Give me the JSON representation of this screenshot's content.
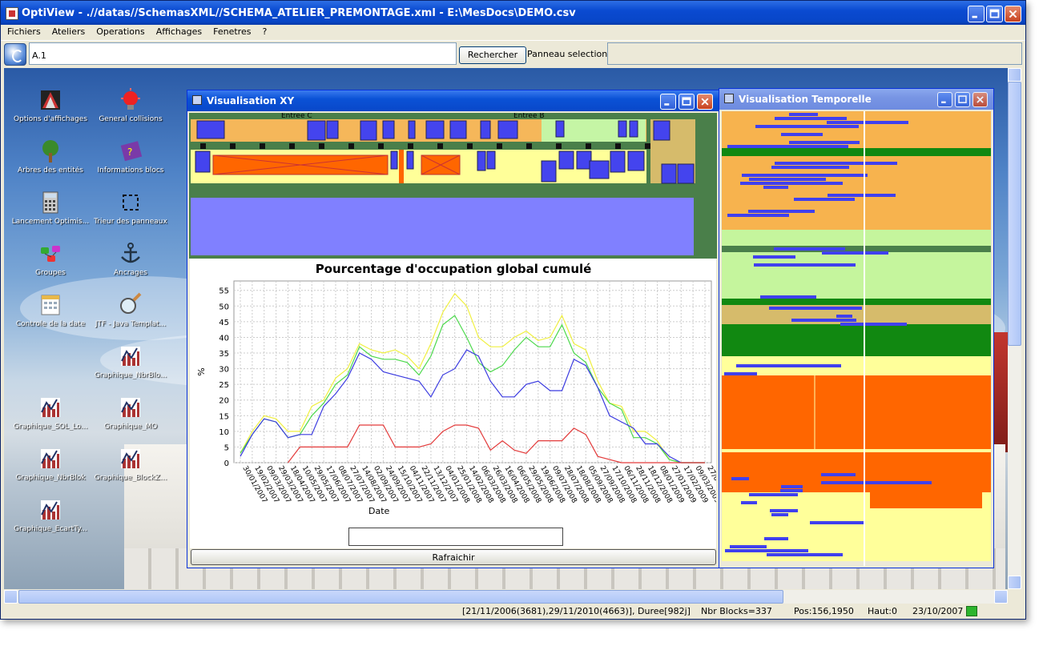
{
  "window": {
    "title": "OptiView - .//datas//SchemasXML//SCHEMA_ATELIER_PREMONTAGE.xml - E:\\MesDocs\\DEMO.csv"
  },
  "menu": [
    "Fichiers",
    "Ateliers",
    "Operations",
    "Affichages",
    "Fenetres",
    "?"
  ],
  "toolbar": {
    "search_value": "A.1",
    "search_button": "Rechercher",
    "panel_label": "Panneau selectionne"
  },
  "desktop_icons": [
    {
      "label": "Options d'affichages",
      "icon": "display-options-icon"
    },
    {
      "label": "General collisions",
      "icon": "collision-alarm-icon"
    },
    {
      "label": "Arbres des entités",
      "icon": "tree-icon"
    },
    {
      "label": "Informations blocs",
      "icon": "help-book-icon"
    },
    {
      "label": "Lancement Optimis...",
      "icon": "calculator-icon"
    },
    {
      "label": "Trieur des panneaux",
      "icon": "sorter-icon"
    },
    {
      "label": "Groupes",
      "icon": "groups-icon"
    },
    {
      "label": "Ancrages",
      "icon": "anchor-icon"
    },
    {
      "label": "Controle de la date",
      "icon": "calendar-icon"
    },
    {
      "label": "JTF - Java Templat...",
      "icon": "magnifier-icon"
    },
    {
      "label": "Graphique_NbrBlo...",
      "icon": "chart-icon"
    },
    {
      "label": "Graphique_SOL_Lo...",
      "icon": "chart-icon"
    },
    {
      "label": "Graphique_MO",
      "icon": "chart-icon"
    },
    {
      "label": "Graphique_NbrBlok",
      "icon": "chart-icon"
    },
    {
      "label": "Graphique_BlockZ...",
      "icon": "chart-icon"
    },
    {
      "label": "Graphique_EcartTy...",
      "icon": "chart-icon"
    }
  ],
  "xy_window": {
    "title": "Visualisation XY",
    "labels": [
      "Entree C",
      "Entree B"
    ],
    "refresh_label": "Rafraichir",
    "input_value": ""
  },
  "temporal_window": {
    "title": "Visualisation Temporelle"
  },
  "status": {
    "range": "[21/11/2006(3681),29/11/2010(4663)], Duree[982j]",
    "blocks": "Nbr Blocks=337",
    "pos": "Pos:156,1950",
    "haut": "Haut:0",
    "date": "23/10/2007"
  },
  "colors": {
    "title_bar": "#0a4ad1",
    "grid": "#cccccc",
    "series_red": "#e33b3b",
    "series_blue": "#3b3be0",
    "series_green": "#4cd94c",
    "series_yellow": "#f0f040"
  },
  "chart_data": {
    "type": "line",
    "title": "Pourcentage d'occupation global cumulé",
    "xlabel": "Date",
    "ylabel": "%",
    "ylim": [
      0,
      58
    ],
    "yticks": [
      0,
      5,
      10,
      15,
      20,
      25,
      30,
      35,
      40,
      45,
      50,
      55
    ],
    "grid": true,
    "categories": [
      "30/01/2007",
      "19/02/2007",
      "09/03/2007",
      "29/03/2007",
      "18/04/2007",
      "10/05/2007",
      "29/05/2007",
      "17/06/2007",
      "08/07/2007",
      "27/07/2007",
      "14/08/2007",
      "02/09/2007",
      "24/09/2007",
      "15/10/2007",
      "04/11/2007",
      "22/11/2007",
      "13/12/2007",
      "04/01/2008",
      "25/01/2008",
      "14/02/2008",
      "06/03/2008",
      "26/03/2008",
      "16/04/2008",
      "06/05/2008",
      "29/05/2008",
      "19/06/2008",
      "09/07/2008",
      "28/07/2008",
      "18/08/2008",
      "05/09/2008",
      "27/09/2008",
      "17/10/2008",
      "06/11/2008",
      "28/11/2008",
      "18/12/2008",
      "08/01/2009",
      "27/01/2009",
      "17/02/2009",
      "09/03/2009",
      "27/04/2009"
    ],
    "series": [
      {
        "values": [
          3,
          10,
          15,
          14,
          10,
          10,
          18,
          20,
          27,
          30,
          38,
          36,
          35,
          36,
          34,
          30,
          38,
          48,
          54,
          50,
          40,
          37,
          37,
          40,
          42,
          39,
          40,
          47,
          38,
          36,
          26,
          19,
          18,
          10,
          10,
          7,
          1,
          0,
          0,
          0
        ],
        "color": "#f0f040"
      },
      {
        "values": [
          3,
          9,
          14,
          13,
          8,
          9,
          15,
          19,
          25,
          28,
          37,
          34,
          33,
          33,
          32,
          28,
          34,
          44,
          47,
          40,
          32,
          29,
          31,
          36,
          40,
          37,
          37,
          44,
          35,
          32,
          24,
          19,
          17,
          8,
          8,
          6,
          1,
          0,
          0,
          0
        ],
        "color": "#4cd94c"
      },
      {
        "values": [
          2,
          9,
          14,
          13,
          8,
          9,
          9,
          18,
          22,
          27,
          35,
          33,
          29,
          28,
          27,
          26,
          21,
          28,
          30,
          36,
          34,
          26,
          21,
          21,
          25,
          26,
          23,
          23,
          33,
          31,
          24,
          15,
          13,
          11,
          6,
          6,
          2,
          0,
          0,
          0
        ],
        "color": "#3b3be0"
      },
      {
        "values": [
          null,
          null,
          null,
          null,
          0,
          5,
          5,
          5,
          5,
          5,
          12,
          12,
          12,
          5,
          5,
          5,
          6,
          10,
          12,
          12,
          11,
          4,
          7,
          4,
          3,
          7,
          7,
          7,
          11,
          9,
          2,
          1,
          0,
          0,
          0,
          0,
          0,
          0,
          0,
          0
        ],
        "color": "#e33b3b"
      }
    ]
  }
}
